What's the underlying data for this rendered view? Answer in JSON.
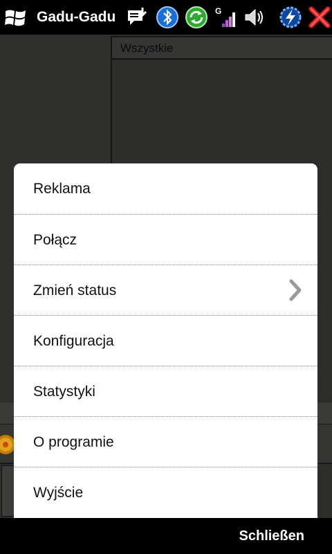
{
  "titlebar": {
    "app_title": "Gadu-Gadu",
    "icons": [
      "windows-logo-icon",
      "notification-icon",
      "bluetooth-icon",
      "sync-icon",
      "signal-strength-icon",
      "volume-icon",
      "battery-charging-icon",
      "close-icon"
    ],
    "signal_network_letter": "G"
  },
  "background": {
    "list_header": "Wszystkie"
  },
  "menu": {
    "items": [
      {
        "label": "Reklama"
      },
      {
        "label": "Połącz"
      },
      {
        "label": "Zmień status",
        "has_submenu": true
      },
      {
        "label": "Konfiguracja"
      },
      {
        "label": "Statystyki"
      },
      {
        "label": "O programie"
      },
      {
        "label": "Wyjście"
      }
    ]
  },
  "softkeys": {
    "right": "Schließen"
  },
  "colors": {
    "background": "#2e2f2d",
    "bar": "#000000",
    "menu": "#ffffff",
    "bluetooth": "#1a6fd6",
    "sync": "#2ea82e",
    "close": "#e02020"
  }
}
